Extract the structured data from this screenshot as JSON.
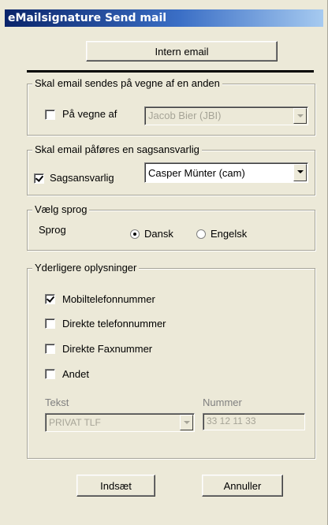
{
  "window": {
    "title": "eMailsignature Send mail"
  },
  "intern_button": "Intern email",
  "behalf_group": {
    "legend": "Skal email sendes på vegne af en anden",
    "checkbox_label": "På vegne af",
    "checked": false,
    "combo_value": "Jacob Bier (JBI)",
    "disabled": true
  },
  "case_group": {
    "legend": "Skal email påføres en sagsansvarlig",
    "checkbox_label": "Sagsansvarlig",
    "checked": true,
    "combo_value": "Casper Münter (cam)"
  },
  "language_group": {
    "legend": "Vælg sprog",
    "label": "Sprog",
    "options": [
      {
        "label": "Dansk",
        "selected": true
      },
      {
        "label": "Engelsk",
        "selected": false
      }
    ]
  },
  "info_group": {
    "legend": "Yderligere oplysninger",
    "checkboxes": [
      {
        "label": "Mobiltelefonnummer",
        "checked": true
      },
      {
        "label": "Direkte telefonnummer",
        "checked": false
      },
      {
        "label": "Direkte Faxnummer",
        "checked": false
      },
      {
        "label": "Andet",
        "checked": false
      }
    ],
    "text_label": "Tekst",
    "text_value": "PRIVAT TLF",
    "number_label": "Nummer",
    "number_value": "33 12 11 33"
  },
  "footer": {
    "insert_button": "Indsæt",
    "cancel_button": "Annuller"
  }
}
